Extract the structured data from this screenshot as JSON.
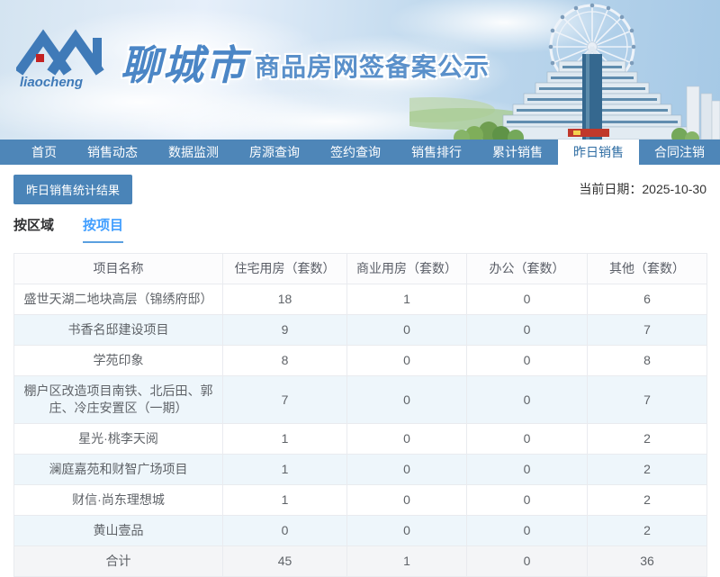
{
  "banner": {
    "logo_script_text": "liaocheng",
    "city_name": "聊城市",
    "title": "商品房网签备案公示"
  },
  "nav": {
    "items": [
      {
        "label": "首页",
        "active": false
      },
      {
        "label": "销售动态",
        "active": false
      },
      {
        "label": "数据监测",
        "active": false
      },
      {
        "label": "房源查询",
        "active": false
      },
      {
        "label": "签约查询",
        "active": false
      },
      {
        "label": "销售排行",
        "active": false
      },
      {
        "label": "累计销售",
        "active": false
      },
      {
        "label": "昨日销售",
        "active": true
      },
      {
        "label": "合同注销",
        "active": false
      }
    ]
  },
  "toolbar": {
    "stats_button": "昨日销售统计结果",
    "date_label": "当前日期：",
    "date_value": "2025-10-30"
  },
  "tabs": [
    {
      "label": "按区域",
      "active": false
    },
    {
      "label": "按项目",
      "active": true
    }
  ],
  "table": {
    "headers": [
      "项目名称",
      "住宅用房（套数）",
      "商业用房（套数）",
      "办公（套数）",
      "其他（套数）"
    ],
    "rows": [
      {
        "project": "盛世天湖二地块高层（锦绣府邸）",
        "residential": "18",
        "commercial": "1",
        "office": "0",
        "other": "6"
      },
      {
        "project": "书香名邸建设项目",
        "residential": "9",
        "commercial": "0",
        "office": "0",
        "other": "7"
      },
      {
        "project": "学苑印象",
        "residential": "8",
        "commercial": "0",
        "office": "0",
        "other": "8"
      },
      {
        "project": "棚户区改造项目南铁、北后田、郭庄、冷庄安置区（一期）",
        "residential": "7",
        "commercial": "0",
        "office": "0",
        "other": "7"
      },
      {
        "project": "星光·桃李天阅",
        "residential": "1",
        "commercial": "0",
        "office": "0",
        "other": "2"
      },
      {
        "project": "澜庭嘉苑和财智广场项目",
        "residential": "1",
        "commercial": "0",
        "office": "0",
        "other": "2"
      },
      {
        "project": "财信·尚东理想城",
        "residential": "1",
        "commercial": "0",
        "office": "0",
        "other": "2"
      },
      {
        "project": "黄山壹品",
        "residential": "0",
        "commercial": "0",
        "office": "0",
        "other": "2"
      }
    ],
    "total": {
      "label": "合计",
      "residential": "45",
      "commercial": "1",
      "office": "0",
      "other": "36"
    }
  },
  "colors": {
    "nav_blue": "#4e86b8",
    "button_blue": "#4a84b8",
    "accent_blue": "#409eff",
    "title_blue": "#5a90ca",
    "stripe_bg": "#eef6fb",
    "total_bg": "#f4f5f7",
    "table_border": "#e9ebef",
    "logo_red": "#c32222"
  }
}
